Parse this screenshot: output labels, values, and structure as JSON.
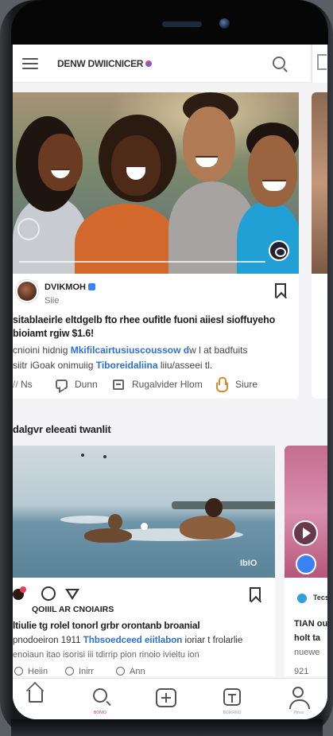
{
  "topbar": {
    "title": "DENW DWIICNICER"
  },
  "post1": {
    "author": "DVIKMOH",
    "subtitle": "Siie",
    "headline_line1": "sitablaeirle eltdgelb fto rhee oufitle fuoni aiiesl sioffuyeho",
    "headline_line2": "bioiamt rgiw $1.6!",
    "body_line1_prefix": "cnioini hidnig",
    "body_line1_link": "Mkifilcairtusiuscoussow d",
    "body_line1_suffix": "w l at badfuits",
    "body_line2_prefix": "siitr iGoak onimuiig",
    "body_line2_link": "Tiboreidaliina",
    "body_line2_suffix": "liiu/asseei tl.",
    "actions": {
      "react": "Ns",
      "comment": "Dunn",
      "share": "Rugalvider Hlom",
      "like": "Siure"
    }
  },
  "section": {
    "title": "dalgvr eleeati twanlit"
  },
  "post2": {
    "photo_tag": "IbIO",
    "author": "QOIIIL AR CNOIAIRS",
    "line1": "ltiulie tg rolel tonorl grbr orontanb broanial",
    "line2_prefix": "pnodoeiron 1911",
    "line2_link": "Thbsoedceed eiitlabon",
    "line2_suffix": "ioriar t frolarlie",
    "line3": "enoiaun itao isorisi iii tdirrip pion rinoio ivieitu ion",
    "mini_actions": [
      "Heiin",
      "Inirr",
      "Ann"
    ]
  },
  "peek": {
    "card2_text_small": "Tecs",
    "card2_line1": "TIAN oui",
    "card2_line2": "holt ta",
    "card2_line3": "nuewe",
    "card2_counter": "921"
  },
  "nav": {
    "search_label": "BONIO",
    "box_label": "BOIKRNO",
    "profile_label": "Pinoo"
  }
}
